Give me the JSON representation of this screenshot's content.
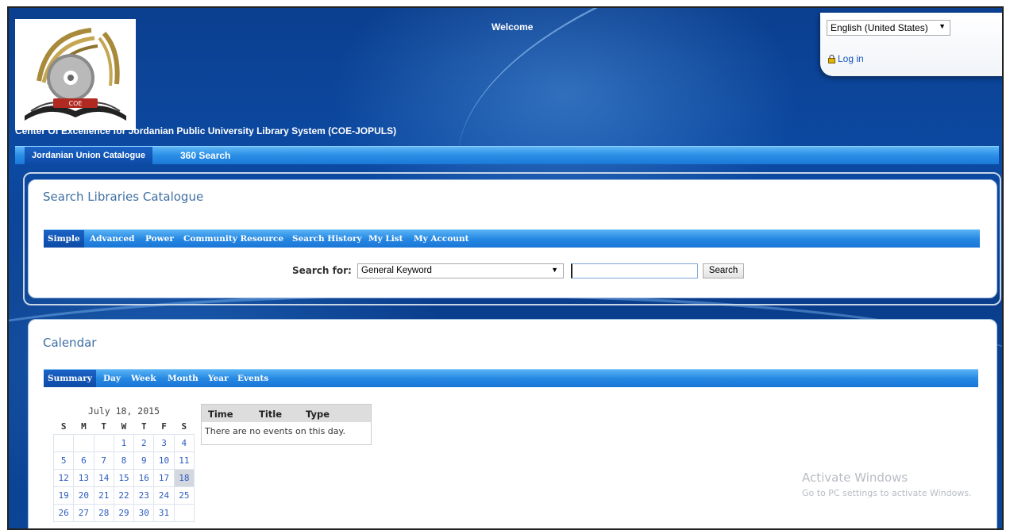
{
  "header": {
    "welcome": "Welcome",
    "site_title": "Center Of Excellence for Jordanian Public University Library System (COE-JOPULS)",
    "logo_text": "COE"
  },
  "language": {
    "selected": "English (United States)"
  },
  "auth": {
    "login_label": "Log in"
  },
  "topnav": {
    "items": [
      "Jordanian Union Catalogue",
      "360 Search"
    ],
    "active": "Jordanian Union Catalogue"
  },
  "search_panel": {
    "title": "Search Libraries Catalogue",
    "tabs": [
      "Simple",
      "Advanced",
      "Power",
      "Community Resource",
      "Search History",
      "My List",
      "My Account"
    ],
    "active_tab": "Simple",
    "search_for_label": "Search for:",
    "search_type": "General Keyword",
    "query": "",
    "search_button": "Search"
  },
  "calendar_panel": {
    "title": "Calendar",
    "tabs": [
      "Summary",
      "Day",
      "Week",
      "Month",
      "Year",
      "Events"
    ],
    "active_tab": "Summary",
    "mini_calendar": {
      "caption": "July 18, 2015",
      "weekdays": [
        "S",
        "M",
        "T",
        "W",
        "T",
        "F",
        "S"
      ],
      "weeks": [
        [
          "",
          "",
          "",
          "1",
          "2",
          "3",
          "4"
        ],
        [
          "5",
          "6",
          "7",
          "8",
          "9",
          "10",
          "11"
        ],
        [
          "12",
          "13",
          "14",
          "15",
          "16",
          "17",
          "18"
        ],
        [
          "19",
          "20",
          "21",
          "22",
          "23",
          "24",
          "25"
        ],
        [
          "26",
          "27",
          "28",
          "29",
          "30",
          "31",
          ""
        ]
      ],
      "selected_day": "18"
    },
    "events": {
      "columns": [
        "Time",
        "Title",
        "Type"
      ],
      "empty_message": "There are no events on this day."
    }
  },
  "watermark": {
    "line1": "Activate Windows",
    "line2": "Go to PC settings to activate Windows."
  },
  "colors": {
    "background": "#0c4aa3",
    "nav_bar": "#2a8ee6",
    "panel_title": "#3f6fa3",
    "link": "#2a5bbf"
  }
}
